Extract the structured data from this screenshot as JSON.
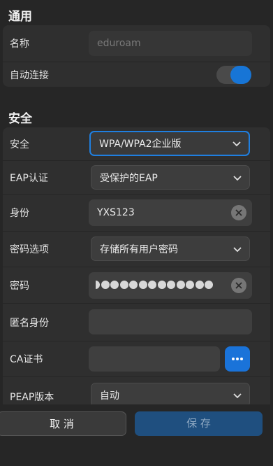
{
  "general": {
    "title": "通用",
    "name_label": "名称",
    "name_value": "eduroam",
    "autoconnect_label": "自动连接",
    "autoconnect_on": true
  },
  "security": {
    "title": "安全",
    "security_label": "安全",
    "security_value": "WPA/WPA2企业版",
    "eap_label": "EAP认证",
    "eap_value": "受保护的EAP",
    "identity_label": "身份",
    "identity_value": "YXS123",
    "password_option_label": "密码选项",
    "password_option_value": "存储所有用户密码",
    "password_label": "密码",
    "anonymous_label": "匿名身份",
    "anonymous_value": "",
    "ca_label": "CA证书",
    "ca_value": "",
    "peap_label": "PEAP版本",
    "peap_value": "自动"
  },
  "footer": {
    "cancel_label": "取 消",
    "save_label": "保 存"
  },
  "colors": {
    "accent": "#1a73d9",
    "background": "#262626",
    "card": "#2f2f2f"
  }
}
